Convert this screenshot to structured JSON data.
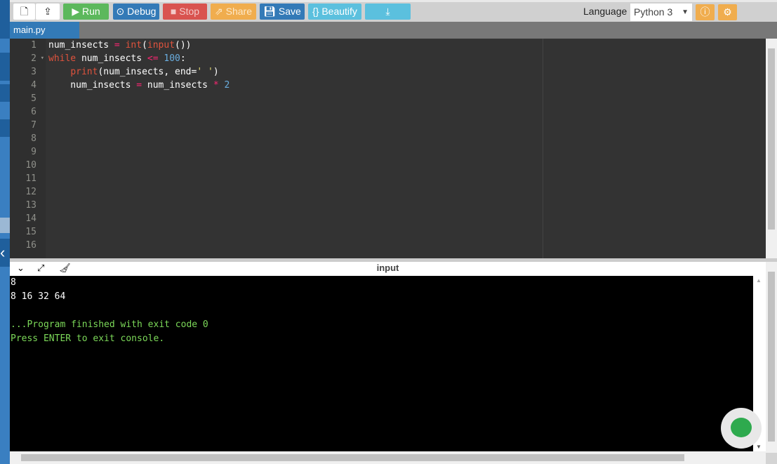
{
  "toolbar": {
    "run": "Run",
    "debug": "Debug",
    "stop": "Stop",
    "share": "Share",
    "save": "Save",
    "beautify": "{} Beautify",
    "language_label": "Language",
    "language_value": "Python 3"
  },
  "colors": {
    "run": "#5cb85c",
    "debug": "#337ab7",
    "stop": "#d9534f",
    "share": "#f0ad4e",
    "save": "#337ab7",
    "beautify": "#5bc0de",
    "download": "#5bc0de"
  },
  "tab": {
    "name": "main.py"
  },
  "editor": {
    "line_numbers": [
      "1",
      "2",
      "3",
      "4",
      "5",
      "6",
      "7",
      "8",
      "9",
      "10",
      "11",
      "12",
      "13",
      "14",
      "15",
      "16"
    ],
    "lines": [
      [
        {
          "t": "num_insects ",
          "c": "#fff"
        },
        {
          "t": "= ",
          "c": "#f92672"
        },
        {
          "t": "int",
          "c": "#e0533d"
        },
        {
          "t": "(",
          "c": "#fff"
        },
        {
          "t": "input",
          "c": "#e0533d"
        },
        {
          "t": "())",
          "c": "#fff"
        }
      ],
      [
        {
          "t": "while",
          "c": "#e0533d"
        },
        {
          "t": " num_insects ",
          "c": "#fff"
        },
        {
          "t": "<=",
          "c": "#f92672"
        },
        {
          "t": " ",
          "c": "#fff"
        },
        {
          "t": "100",
          "c": "#6aaee0"
        },
        {
          "t": ":",
          "c": "#fff"
        }
      ],
      [
        {
          "t": "    ",
          "c": "#fff"
        },
        {
          "t": "print",
          "c": "#e0533d"
        },
        {
          "t": "(num_insects, end=",
          "c": "#fff"
        },
        {
          "t": "' '",
          "c": "#e6db74"
        },
        {
          "t": ")",
          "c": "#fff"
        }
      ],
      [
        {
          "t": "    num_insects ",
          "c": "#fff"
        },
        {
          "t": "=",
          "c": "#f92672"
        },
        {
          "t": " num_insects ",
          "c": "#fff"
        },
        {
          "t": "*",
          "c": "#f92672"
        },
        {
          "t": " ",
          "c": "#fff"
        },
        {
          "t": "2",
          "c": "#6aaee0"
        }
      ]
    ]
  },
  "console": {
    "title": "input",
    "lines": [
      {
        "text": "8",
        "color": "#ffffff"
      },
      {
        "text": "8 16 32 64",
        "color": "#ffffff"
      },
      {
        "text": "",
        "color": "#ffffff"
      },
      {
        "text": "...Program finished with exit code 0",
        "color": "#7cd959"
      },
      {
        "text": "Press ENTER to exit console.",
        "color": "#7cd959"
      }
    ]
  }
}
